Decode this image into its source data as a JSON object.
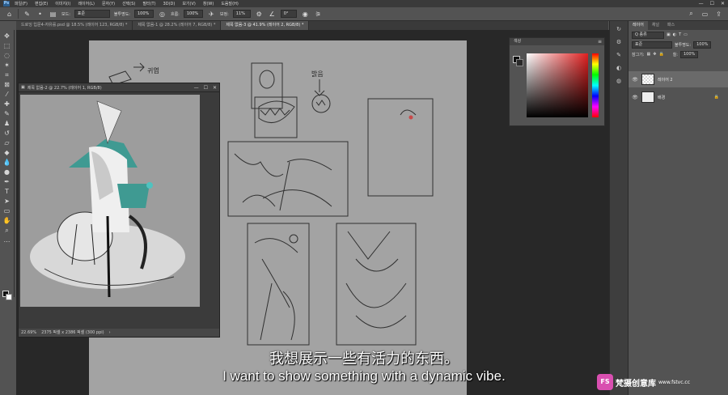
{
  "menubar": {
    "items": [
      "파일(F)",
      "편집(E)",
      "이미지(I)",
      "레이어(L)",
      "문자(Y)",
      "선택(S)",
      "필터(T)",
      "3D(D)",
      "보기(V)",
      "창(W)",
      "도움말(H)"
    ],
    "window_controls": [
      "—",
      "☐",
      "✕"
    ]
  },
  "options": {
    "mode_label": "모드:",
    "mode_value": "표준",
    "opacity_label": "불투명도:",
    "opacity_value": "100%",
    "flow_label": "흐름:",
    "flow_value": "100%",
    "smoothing_label": "보정:",
    "smoothing_value": "11%",
    "angle_value": "0°"
  },
  "tabs": [
    {
      "label": "드로잉 입문4-자유를.psd @ 18.5% (레이어 123, RGB/8) *",
      "active": false
    },
    {
      "label": "제목 없음-1 @ 28.2% (레이어 7, RGB/8) *",
      "active": false
    },
    {
      "label": "제목 없음-3 @ 41.9% (레이어 2, RGB/8) *",
      "active": true
    }
  ],
  "float_window": {
    "title": "제목 없음-2 @ 22.7% (레이어 1, RGB/8)",
    "zoom": "22.69%",
    "doc_size": "2375 픽셀 x 2386 픽셀 (300 ppi)"
  },
  "color_panel": {
    "title": "색상"
  },
  "layers_panel": {
    "tabs": [
      "레이어",
      "채널",
      "패스"
    ],
    "kind_label": "Q 종류",
    "blend_mode": "표준",
    "opacity_label": "불투명도:",
    "opacity_value": "100%",
    "lock_label": "잠그기:",
    "fill_label": "칠:",
    "fill_value": "100%",
    "layers": [
      {
        "name": "레이어 2",
        "selected": true
      },
      {
        "name": "배경",
        "selected": false
      }
    ]
  },
  "subtitle": {
    "cn": "我想展示一些有活力的东西。",
    "en": "I want to show something with a dynamic vibe."
  },
  "watermark": {
    "logo": "FS",
    "name": "梵摄创意库",
    "url": "www.fstvc.cc"
  },
  "annotations": {
    "sketch_note_1": "귀엽",
    "sketch_note_2": "밝음"
  }
}
